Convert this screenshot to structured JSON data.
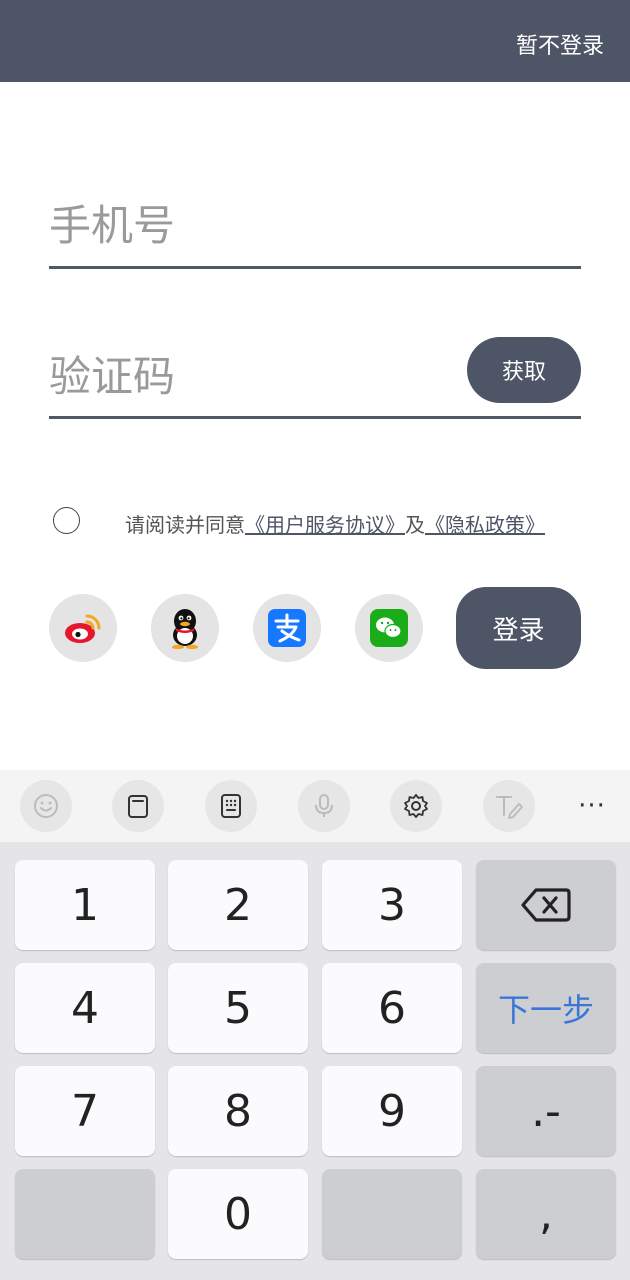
{
  "header": {
    "skip_login": "暂不登录"
  },
  "form": {
    "phone_placeholder": "手机号",
    "code_placeholder": "验证码",
    "get_code": "获取"
  },
  "agreement": {
    "prefix": "请阅读并同意",
    "user_agreement": "《用户服务协议》",
    "and": "及",
    "privacy_policy": "《隐私政策》"
  },
  "social": {
    "icons": [
      "weibo-icon",
      "qq-icon",
      "alipay-icon",
      "wechat-icon"
    ],
    "login": "登录"
  },
  "keyboard": {
    "toolbar_icons": [
      "emoji-icon",
      "clipboard-icon",
      "keyboard-layout-icon",
      "microphone-icon",
      "settings-icon",
      "handwriting-icon",
      "more-icon"
    ],
    "more": "···",
    "keys": {
      "k1": "1",
      "k2": "2",
      "k3": "3",
      "k4": "4",
      "k5": "5",
      "k6": "6",
      "k7": "7",
      "k8": "8",
      "k9": "9",
      "k0": "0",
      "next": "下一步",
      "dot_dash": ".-",
      "comma": ","
    }
  },
  "colors": {
    "header_bg": "#4e5566",
    "accent_blue": "#3a76d8",
    "keyboard_bg": "#e5e5e7"
  }
}
